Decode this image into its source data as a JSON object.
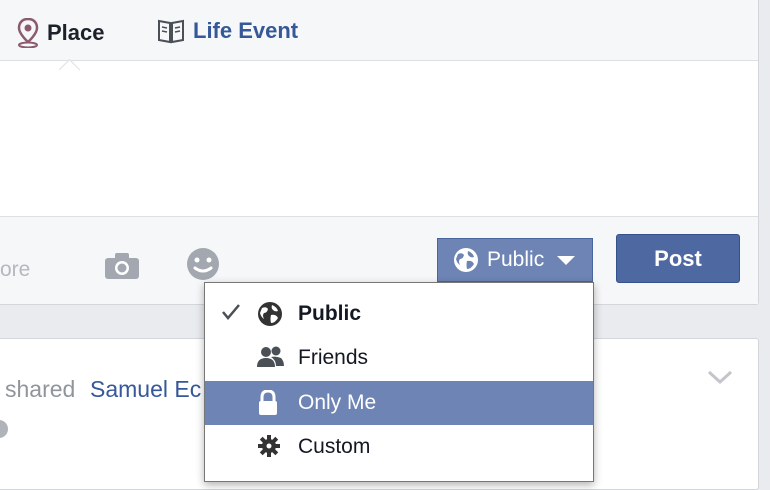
{
  "composer": {
    "tabs": [
      {
        "label": "Place",
        "icon": "map-pin-icon"
      },
      {
        "label": "Life Event",
        "icon": "book-icon"
      }
    ],
    "more_label": "ore",
    "privacy_label": "Public",
    "post_label": "Post"
  },
  "privacy_menu": {
    "items": [
      {
        "label": "Public",
        "icon": "globe-icon",
        "selected": true
      },
      {
        "label": "Friends",
        "icon": "friends-icon"
      },
      {
        "label": "Only Me",
        "icon": "lock-icon",
        "highlighted": true
      },
      {
        "label": "Custom",
        "icon": "gear-icon"
      }
    ]
  },
  "feed": {
    "shared_text": "shared",
    "shared_name": "Samuel Ec"
  },
  "colors": {
    "accent": "#4e69a2",
    "menu_highlight": "#6d84b4",
    "link": "#365899"
  }
}
